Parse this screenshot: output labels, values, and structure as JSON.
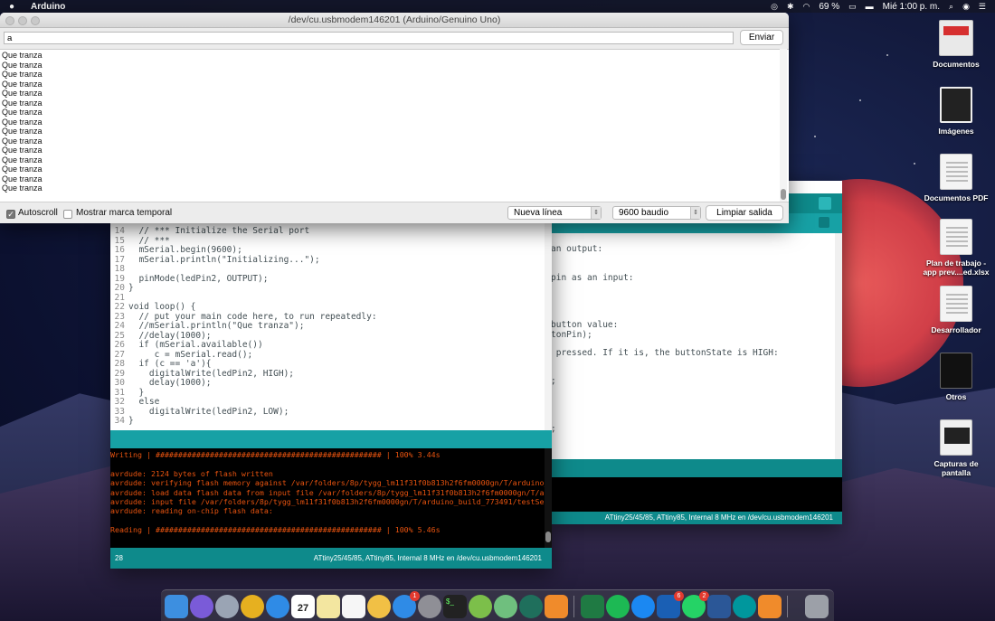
{
  "menubar": {
    "app_name": "Arduino",
    "battery": "69 %",
    "clock": "Mié 1:00 p. m."
  },
  "serial_monitor": {
    "title": "/dev/cu.usbmodem146201 (Arduino/Genuino Uno)",
    "input_value": "a",
    "send_label": "Enviar",
    "output_lines": [
      "Que tranza",
      "Que tranza",
      "Que tranza",
      "Que tranza",
      "Que tranza",
      "Que tranza",
      "Que tranza",
      "Que tranza",
      "Que tranza",
      "Que tranza",
      "Que tranza",
      "Que tranza",
      "Que tranza",
      "Que tranza",
      "Que tranza"
    ],
    "autoscroll_label": "Autoscroll",
    "autoscroll_checked": true,
    "timestamp_label": "Mostrar marca temporal",
    "timestamp_checked": false,
    "line_ending": "Nueva línea",
    "baud_rate": "9600 baudio",
    "clear_label": "Limpiar salida"
  },
  "editor": {
    "code_lines": [
      {
        "n": "14",
        "t": "  // *** Initialize the Serial port"
      },
      {
        "n": "15",
        "t": "  // ***"
      },
      {
        "n": "16",
        "t": "  mSerial.begin(9600);"
      },
      {
        "n": "17",
        "t": "  mSerial.println(\"Initializing...\");"
      },
      {
        "n": "18",
        "t": ""
      },
      {
        "n": "19",
        "t": "  pinMode(ledPin2, OUTPUT);"
      },
      {
        "n": "20",
        "t": "}"
      },
      {
        "n": "21",
        "t": ""
      },
      {
        "n": "22",
        "t": "void loop() {"
      },
      {
        "n": "23",
        "t": "  // put your main code here, to run repeatedly:"
      },
      {
        "n": "24",
        "t": "  //mSerial.println(\"Que tranza\");"
      },
      {
        "n": "25",
        "t": "  //delay(1000);"
      },
      {
        "n": "26",
        "t": "  if (mSerial.available())"
      },
      {
        "n": "27",
        "t": "     c = mSerial.read();"
      },
      {
        "n": "28",
        "t": "  if (c == 'a'){"
      },
      {
        "n": "29",
        "t": "    digitalWrite(ledPin2, HIGH);"
      },
      {
        "n": "30",
        "t": "    delay(1000);"
      },
      {
        "n": "31",
        "t": "  }"
      },
      {
        "n": "32",
        "t": "  else"
      },
      {
        "n": "33",
        "t": "    digitalWrite(ledPin2, LOW);"
      },
      {
        "n": "34",
        "t": "}"
      }
    ],
    "console_lines": [
      "Writing | ################################################## | 100% 3.44s",
      "",
      "avrdude: 2124 bytes of flash written",
      "avrdude: verifying flash memory against /var/folders/8p/tygg_lm11f31f0b813h2f6fm0000gn/T/arduino_build_7",
      "avrdude: load data flash data from input file /var/folders/8p/tygg_lm11f31f0b813h2f6fm0000gn/T/arduino_b",
      "avrdude: input file /var/folders/8p/tygg_lm11f31f0b813h2f6fm0000gn/T/arduino_build_773491/testSerial.ino",
      "avrdude: reading on-chip flash data:",
      "",
      "Reading | ################################################## | 100% 5.46s"
    ],
    "status_line": "28",
    "status_board": "ATtiny25/45/85, ATtiny85, Internal 8 MHz en /dev/cu.usbmodem146201"
  },
  "back_editor": {
    "code_fragments": [
      "an output:",
      "pin as an input:",
      "button value:",
      "tonPin);",
      " pressed. If it is, the buttonState is HIGH:",
      ";",
      ";"
    ],
    "status_board": "ATtiny25/45/85, ATtiny85, Internal 8 MHz en /dev/cu.usbmodem146201"
  },
  "desktop_icons": [
    {
      "label": "Documentos"
    },
    {
      "label": "Imágenes"
    },
    {
      "label": "Documentos PDF"
    },
    {
      "label": "Plan de trabajo - app prev....ed.xlsx"
    },
    {
      "label": "Desarrollador"
    },
    {
      "label": "Otros"
    },
    {
      "label": "Capturas de pantalla"
    }
  ],
  "dock": {
    "calendar_day": "27",
    "badge_appstore": "1",
    "badge_outlook": "6",
    "badge_whatsapp": "2"
  }
}
